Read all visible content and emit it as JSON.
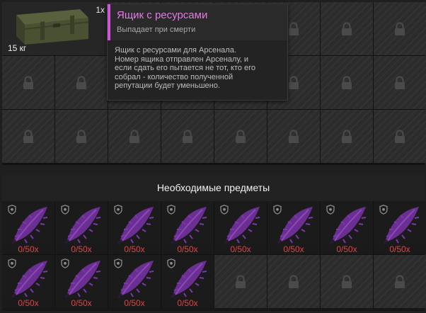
{
  "storage": {
    "crate": {
      "quantity": "1x",
      "weight": "15 кг",
      "icon": "ammo-crate-icon"
    },
    "locked_icon": "lock-icon"
  },
  "tooltip": {
    "title": "Ящик с ресурсами",
    "subtitle": "Выпадает при смерти",
    "description": "Ящик с ресурсами для Арсенала.\nНомер ящика отправлен Арсеналу, и\nесли сдать его пытается не тот, кто его\nсобрал - количество полученной\nрепутации будет уменьшено.",
    "accent_color": "#d255d7"
  },
  "required": {
    "header": "Необходимые предметы",
    "items": [
      {
        "count": "0/50x",
        "icon": "purple-feather-icon"
      },
      {
        "count": "0/50x",
        "icon": "purple-feather-icon"
      },
      {
        "count": "0/50x",
        "icon": "purple-feather-icon"
      },
      {
        "count": "0/50x",
        "icon": "purple-feather-icon"
      },
      {
        "count": "0/50x",
        "icon": "purple-feather-icon"
      },
      {
        "count": "0/50x",
        "icon": "purple-feather-icon"
      },
      {
        "count": "0/50x",
        "icon": "purple-feather-icon"
      },
      {
        "count": "0/50x",
        "icon": "purple-feather-icon"
      },
      {
        "count": "0/50x",
        "icon": "purple-feather-icon"
      },
      {
        "count": "0/50x",
        "icon": "purple-feather-icon"
      },
      {
        "count": "0/50x",
        "icon": "purple-feather-icon"
      },
      {
        "count": "0/50x",
        "icon": "purple-feather-icon"
      }
    ],
    "count_color": "#e14343"
  }
}
